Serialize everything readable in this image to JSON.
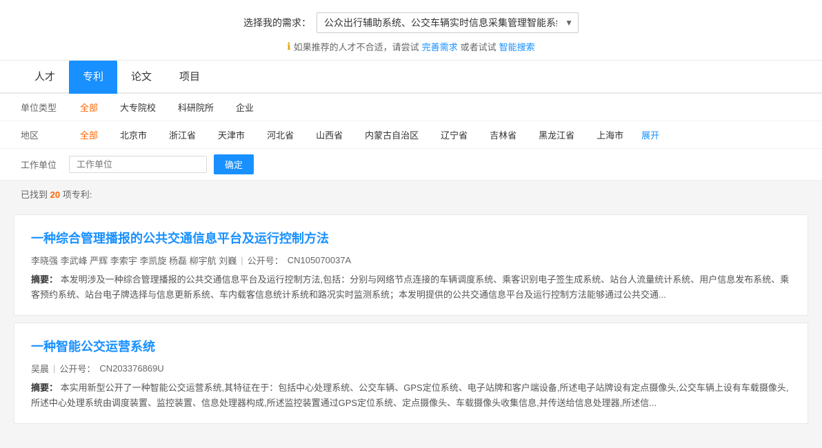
{
  "select_row": {
    "label": "选择我的需求：",
    "value": "公众出行辅助系统、公交车辆实时信息采集管理智能系统",
    "options": [
      "公众出行辅助系统、公交车辆实时信息采集管理智能系统"
    ]
  },
  "info_row": {
    "icon": "ℹ",
    "text": "如果推荐的人才不合适，请尝试",
    "link1_text": "完善需求",
    "middle_text": "或者试试",
    "link2_text": "智能搜索"
  },
  "tabs": [
    {
      "label": "人才",
      "active": false
    },
    {
      "label": "专利",
      "active": true
    },
    {
      "label": "论文",
      "active": false
    },
    {
      "label": "项目",
      "active": false
    }
  ],
  "filters": {
    "unit_type": {
      "label": "单位类型",
      "options": [
        {
          "label": "全部",
          "active": true
        },
        {
          "label": "大专院校",
          "active": false
        },
        {
          "label": "科研院所",
          "active": false
        },
        {
          "label": "企业",
          "active": false
        }
      ]
    },
    "region": {
      "label": "地区",
      "options": [
        {
          "label": "全部",
          "active": true
        },
        {
          "label": "北京市",
          "active": false
        },
        {
          "label": "浙江省",
          "active": false
        },
        {
          "label": "天津市",
          "active": false
        },
        {
          "label": "河北省",
          "active": false
        },
        {
          "label": "山西省",
          "active": false
        },
        {
          "label": "内蒙古自治区",
          "active": false
        },
        {
          "label": "辽宁省",
          "active": false
        },
        {
          "label": "吉林省",
          "active": false
        },
        {
          "label": "黑龙江省",
          "active": false
        },
        {
          "label": "上海市",
          "active": false
        }
      ],
      "show_more_label": "展开"
    },
    "work_unit": {
      "label": "工作单位",
      "placeholder": "工作单位",
      "confirm_label": "确定"
    }
  },
  "results": {
    "found_prefix": "已找到",
    "count": "20",
    "found_suffix": "项专利:",
    "items": [
      {
        "title": "一种综合管理播报的公共交通信息平台及运行控制方法",
        "authors": "李晓强  李武峰  严辉  李索宇  李凯旋  杨磊  柳宇航  刘巍",
        "pub_no_label": "公开号：",
        "pub_no": "CN105070037A",
        "abstract_label": "摘要：",
        "abstract": "本发明涉及一种综合管理播报的公共交通信息平台及运行控制方法,包括：分别与网络节点连接的车辆调度系统、乘客识别电子签生成系统、站台人流量统计系统、用户信息发布系统、乘客预约系统、站台电子牌选择与信息更新系统、车内载客信息统计系统和路况实时监测系统；本发明提供的公共交通信息平台及运行控制方法能够通过公共交通..."
      },
      {
        "title": "一种智能公交运营系统",
        "authors": "吴晨",
        "pub_no_label": "公开号：",
        "pub_no": "CN203376869U",
        "abstract_label": "摘要：",
        "abstract": "本实用新型公开了一种智能公交运营系统,其特征在于：包括中心处理系统、公交车辆、GPS定位系统、电子站牌和客户端设备,所述电子站牌设有定点摄像头,公交车辆上设有车载摄像头,所述中心处理系统由调度装置、监控装置、信息处理器构成,所述监控装置通过GPS定位系统、定点摄像头、车载摄像头收集信息,并传送给信息处理器,所述信..."
      }
    ]
  }
}
